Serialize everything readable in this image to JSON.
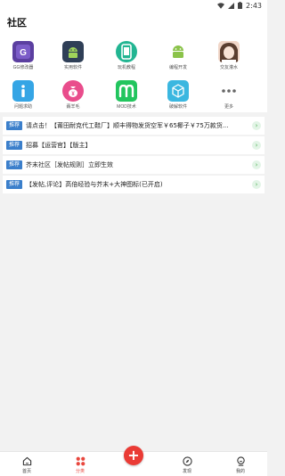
{
  "status_bar": {
    "time": "2:43"
  },
  "header": {
    "title": "社区"
  },
  "grid": {
    "row1": [
      {
        "label": "GG修改器",
        "icon": "gg-app-icon",
        "color": "#5b3fa0"
      },
      {
        "label": "实用软件",
        "icon": "android-dark-app-icon",
        "color": "#2f3f57"
      },
      {
        "label": "玩机教程",
        "icon": "phone-teal-icon",
        "color": "#22b592"
      },
      {
        "label": "编程开发",
        "icon": "android-robot-icon",
        "color": "#ffffff"
      },
      {
        "label": "交友灌水",
        "icon": "avatar-photo-icon",
        "color": "#f1d6c8"
      }
    ],
    "row2": [
      {
        "label": "问题求助",
        "icon": "info-icon",
        "color": "#35a5e5"
      },
      {
        "label": "薅羊毛",
        "icon": "money-bag-icon",
        "color": "#e94d8c"
      },
      {
        "label": "MOD技术",
        "icon": "mod-m-icon",
        "color": "#22c55e"
      },
      {
        "label": "破解软件",
        "icon": "cube-icon",
        "color": "#3bb7e0"
      },
      {
        "label": "更多",
        "icon": "more-dots-icon",
        "color": "#666666"
      }
    ]
  },
  "feed": [
    {
      "tag": "推荐",
      "text": "请点击！【莆田耐克代工鞋厂】顺丰得物发货空军￥65椰子￥75万款货..."
    },
    {
      "tag": "推荐",
      "text": "招募【运营官】【版主】"
    },
    {
      "tag": "推荐",
      "text": "芥末社区［发帖规则］立即生效"
    },
    {
      "tag": "推荐",
      "text": "【发帖,评论】高倍经验与芥末+大神图标(已开启)"
    }
  ],
  "nav": {
    "home": "首页",
    "category": "分类",
    "discover": "发现",
    "mine": "我的",
    "fab": "+"
  },
  "colors": {
    "accent": "#ea3b35",
    "tag": "#3b7fcb",
    "arrow": "#4caf50"
  }
}
